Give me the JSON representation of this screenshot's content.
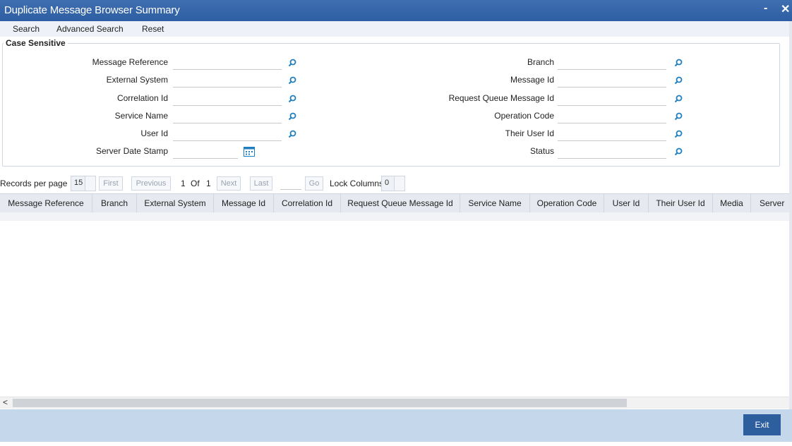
{
  "window": {
    "title": "Duplicate Message Browser Summary",
    "minimize": "-",
    "close": "✕"
  },
  "menu": {
    "search": "Search",
    "advanced_search": "Advanced Search",
    "reset": "Reset"
  },
  "criteria": {
    "legend": "Case Sensitive",
    "left": [
      "Message Reference",
      "External System",
      "Correlation Id",
      "Service Name",
      "User Id",
      "Server Date Stamp"
    ],
    "right": [
      "Branch",
      "Message Id",
      "Request Queue Message Id",
      "Operation Code",
      "Their User Id",
      "Status"
    ]
  },
  "pager": {
    "records_label": "Records per page",
    "records_value": "15",
    "first": "First",
    "previous": "Previous",
    "page_current": "1",
    "of": "Of",
    "page_total": "1",
    "next": "Next",
    "last": "Last",
    "go": "Go",
    "lock_label": "Lock Columns",
    "lock_value": "0"
  },
  "grid": {
    "columns": [
      "Message Reference",
      "Branch",
      "External System",
      "Message Id",
      "Correlation Id",
      "Request Queue Message Id",
      "Service Name",
      "Operation Code",
      "User Id",
      "Their User Id",
      "Media",
      "Server"
    ]
  },
  "footer": {
    "exit": "Exit"
  },
  "colors": {
    "titlebar": "#2e5ea3",
    "footer": "#c5d7ea",
    "accent": "#1f7fc0"
  },
  "icons": {
    "search": "magnifier-icon",
    "calendar": "calendar-icon"
  }
}
